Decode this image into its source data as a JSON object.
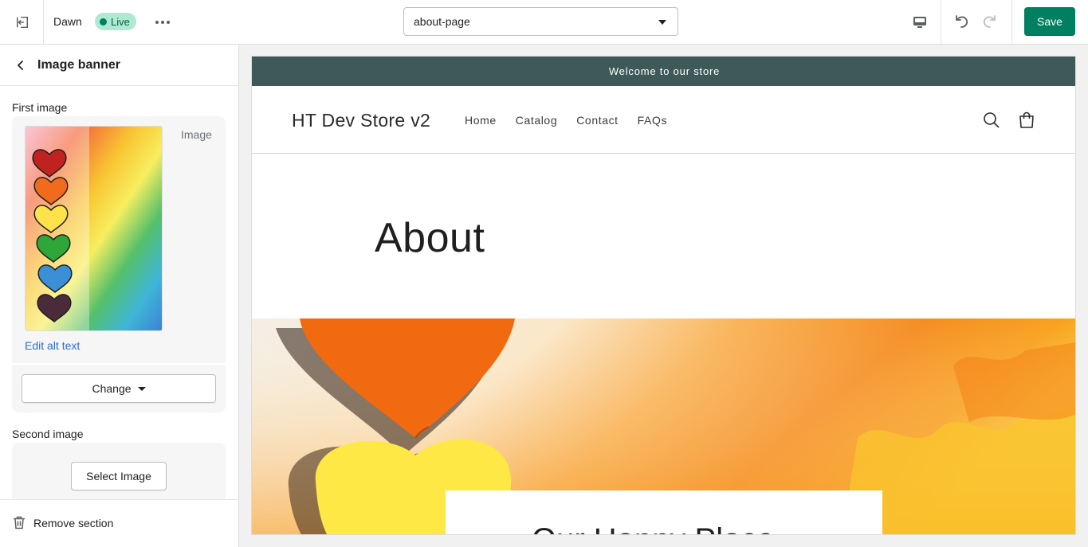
{
  "topbar": {
    "theme_name": "Dawn",
    "live_label": "Live",
    "page_select_value": "about-page",
    "save_label": "Save"
  },
  "sidebar": {
    "title": "Image banner",
    "first_image_label": "First image",
    "image_tag": "Image",
    "edit_alt_text": "Edit alt text",
    "change_label": "Change",
    "second_image_label": "Second image",
    "select_image_label": "Select Image",
    "remove_section_label": "Remove section"
  },
  "preview": {
    "announcement": "Welcome to our store",
    "store_name": "HT Dev Store v2",
    "nav": [
      "Home",
      "Catalog",
      "Contact",
      "FAQs"
    ],
    "page_title": "About",
    "banner_heading": "Our Happy Place"
  },
  "colors": {
    "accent": "#008060",
    "announcement_bg": "#3d5a58",
    "link": "#2c6ecb",
    "live_badge_bg": "#aee9d1"
  },
  "icons": [
    "exit-icon",
    "more-horizontal-icon",
    "chevron-down-icon",
    "desktop-icon",
    "undo-icon",
    "redo-icon",
    "chevron-left-icon",
    "trash-icon",
    "search-icon",
    "cart-icon"
  ]
}
